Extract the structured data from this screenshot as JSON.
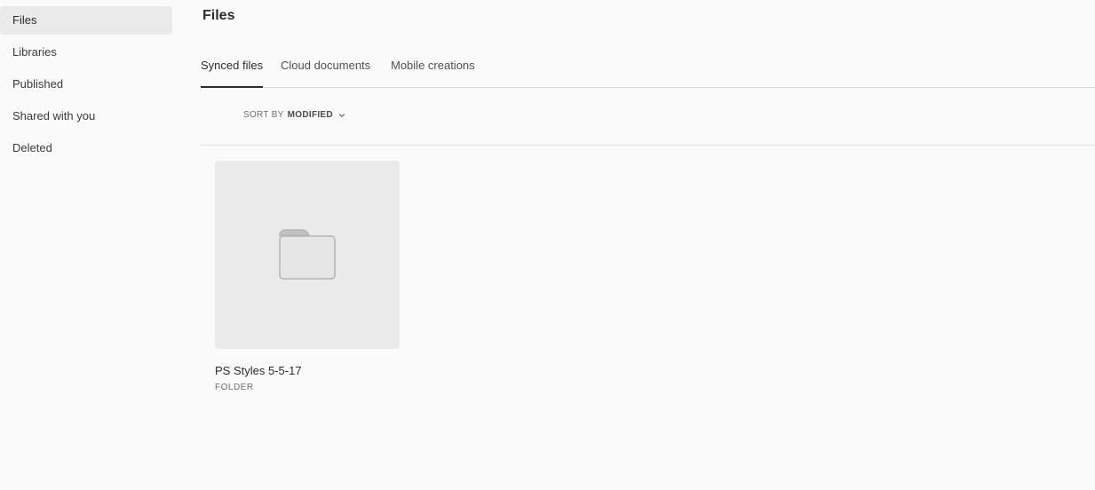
{
  "sidebar": {
    "items": [
      {
        "label": "Files",
        "active": true
      },
      {
        "label": "Libraries",
        "active": false
      },
      {
        "label": "Published",
        "active": false
      },
      {
        "label": "Shared with you",
        "active": false
      },
      {
        "label": "Deleted",
        "active": false
      }
    ]
  },
  "main": {
    "title": "Files",
    "tabs": [
      {
        "label": "Synced files",
        "active": true
      },
      {
        "label": "Cloud documents",
        "active": false
      },
      {
        "label": "Mobile creations",
        "active": false
      }
    ],
    "sort": {
      "prefix": "SORT BY",
      "value": "MODIFIED"
    },
    "items": [
      {
        "name": "PS Styles 5-5-17",
        "type": "FOLDER",
        "icon": "folder-icon"
      }
    ]
  },
  "colors": {
    "background": "#fafafa",
    "active_sidebar_bg": "#eaeaea",
    "thumb_bg": "#eaeaea",
    "folder_fill": "#e6e6e6",
    "folder_stroke": "#b4b4b4"
  }
}
